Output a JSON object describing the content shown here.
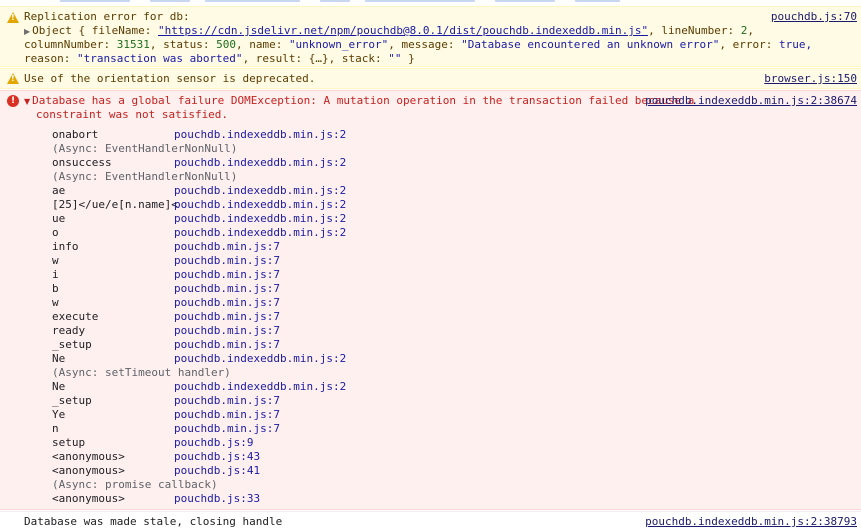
{
  "msg1": {
    "title": "Replication error for db:",
    "source": "pouchdb.js:70",
    "obj": {
      "prefix": "Object { fileName: ",
      "file": "\"https://cdn.jsdelivr.net/npm/pouchdb@8.0.1/dist/pouchdb.indexeddb.min.js\"",
      "after_file": ", lineNumber: ",
      "line_number": "2",
      "comma1": ",",
      "col_key": "columnNumber: ",
      "col_val": "31531",
      "status_key": ", status: ",
      "status_val": "500",
      "name_key": ", name: ",
      "name_val": "\"unknown_error\"",
      "message_key": ", message: ",
      "message_val": "\"Database encountered an unknown error\"",
      "error_key": ", error: ",
      "error_val": "true,",
      "reason_key": "reason: ",
      "reason_val": "\"transaction was aborted\"",
      "result_key": ", result: ",
      "result_val": "{…}",
      "stack_key": ", stack: ",
      "stack_val": "\"\"",
      "close": " }"
    }
  },
  "msg2": {
    "text": "Use of the orientation sensor is deprecated.",
    "source": "browser.js:150"
  },
  "msg3": {
    "text_line1": "Database has a global failure DOMException: A mutation operation in the transaction failed because a",
    "text_line2": "constraint was not satisfied.",
    "source": "pouchdb.indexeddb.min.js:2:38674",
    "frames": [
      {
        "fn": "onabort",
        "loc": "pouchdb.indexeddb.min.js:2"
      },
      {
        "async": "(Async: EventHandlerNonNull)"
      },
      {
        "fn": "onsuccess",
        "loc": "pouchdb.indexeddb.min.js:2"
      },
      {
        "async": "(Async: EventHandlerNonNull)"
      },
      {
        "fn": "ae",
        "loc": "pouchdb.indexeddb.min.js:2"
      },
      {
        "fn": "[25]</ue/e[n.name]<",
        "loc": "pouchdb.indexeddb.min.js:2"
      },
      {
        "fn": "ue",
        "loc": "pouchdb.indexeddb.min.js:2"
      },
      {
        "fn": "o",
        "loc": "pouchdb.indexeddb.min.js:2"
      },
      {
        "fn": "info",
        "loc": "pouchdb.min.js:7"
      },
      {
        "fn": "w",
        "loc": "pouchdb.min.js:7"
      },
      {
        "fn": "i",
        "loc": "pouchdb.min.js:7"
      },
      {
        "fn": "b",
        "loc": "pouchdb.min.js:7"
      },
      {
        "fn": "w",
        "loc": "pouchdb.min.js:7"
      },
      {
        "fn": "execute",
        "loc": "pouchdb.min.js:7"
      },
      {
        "fn": "ready",
        "loc": "pouchdb.min.js:7"
      },
      {
        "fn": "_setup",
        "loc": "pouchdb.min.js:7"
      },
      {
        "fn": "Ne",
        "loc": "pouchdb.indexeddb.min.js:2"
      },
      {
        "async": "(Async: setTimeout handler)"
      },
      {
        "fn": "Ne",
        "loc": "pouchdb.indexeddb.min.js:2"
      },
      {
        "fn": "_setup",
        "loc": "pouchdb.min.js:7"
      },
      {
        "fn": "Ye",
        "loc": "pouchdb.min.js:7"
      },
      {
        "fn": "n",
        "loc": "pouchdb.min.js:7"
      },
      {
        "fn": "setup",
        "loc": "pouchdb.js:9"
      },
      {
        "fn": "<anonymous>",
        "loc": "pouchdb.js:43"
      },
      {
        "fn": "<anonymous>",
        "loc": "pouchdb.js:41"
      },
      {
        "async": "(Async: promise callback)"
      },
      {
        "fn": "<anonymous>",
        "loc": "pouchdb.js:33"
      }
    ]
  },
  "msg4": {
    "text": "Database was made stale, closing handle",
    "source": "pouchdb.indexeddb.min.js:2:38793"
  },
  "colors": {
    "warning_bg": "#fffbe5",
    "error_bg": "#fff0f0",
    "error_icon": "#d93025",
    "warning_icon": "#e3a600",
    "link": "#1a1aa6"
  }
}
